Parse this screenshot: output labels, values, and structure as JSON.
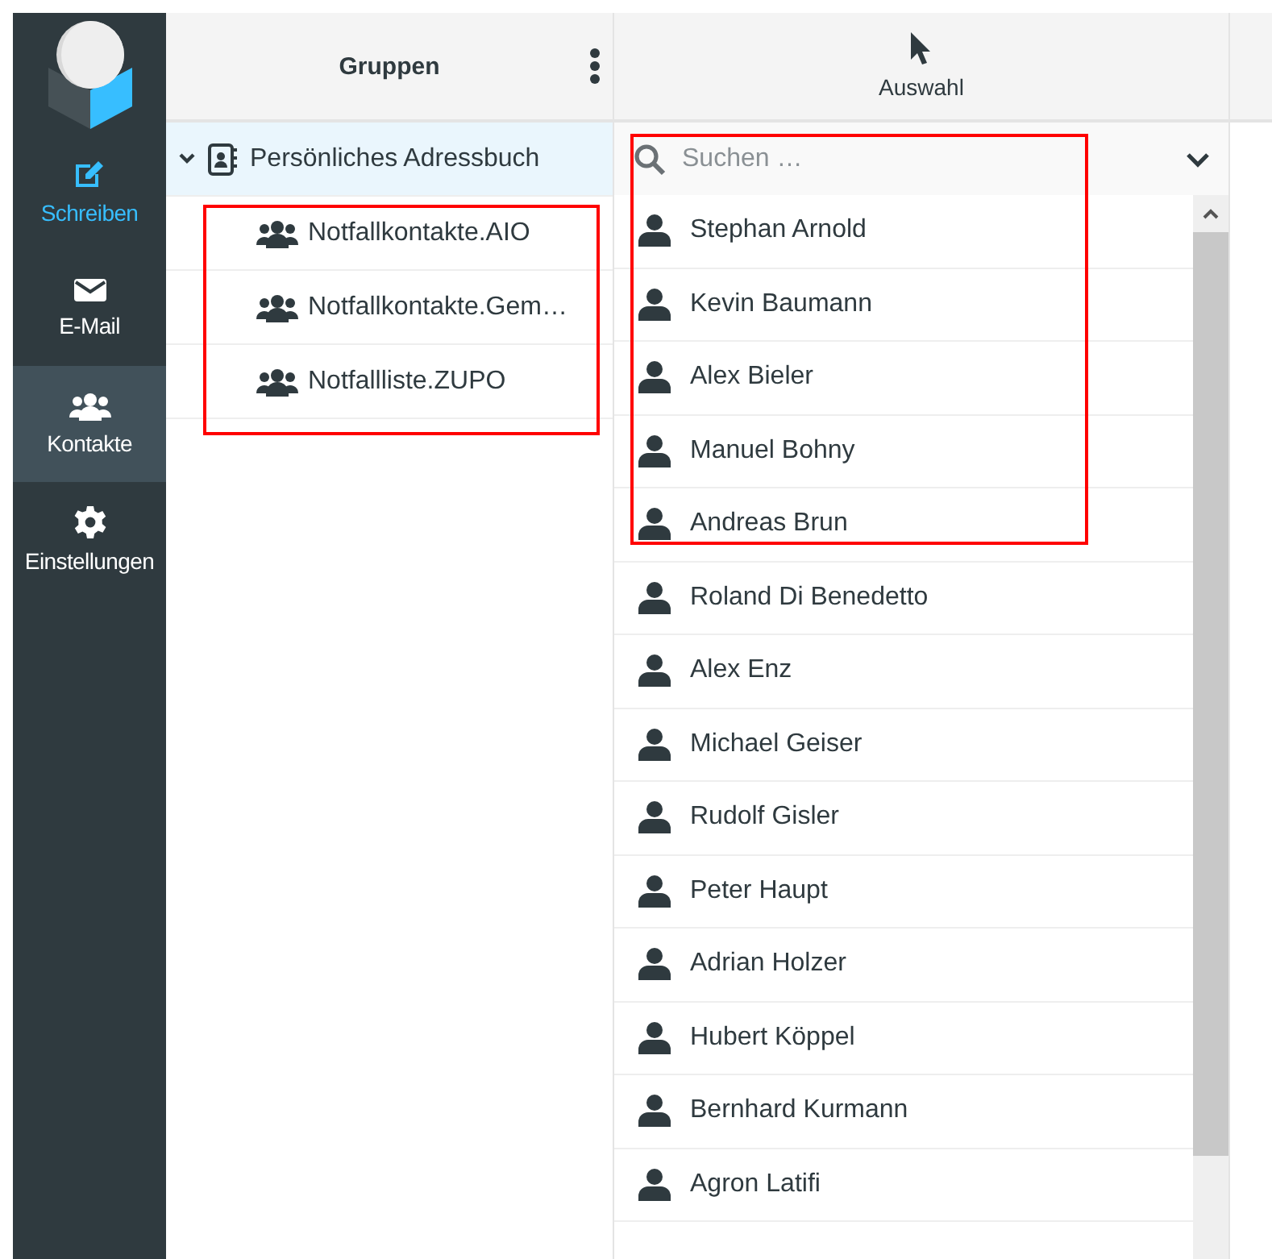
{
  "sidebar": {
    "items": [
      {
        "label": "Schreiben",
        "kind": "compose",
        "selected": false
      },
      {
        "label": "E-Mail",
        "kind": "mail",
        "selected": false
      },
      {
        "label": "Kontakte",
        "kind": "contacts",
        "selected": true
      },
      {
        "label": "Einstellungen",
        "kind": "settings",
        "selected": false
      }
    ]
  },
  "groups_panel": {
    "title": "Gruppen",
    "highlighted": true,
    "addressbook": {
      "label": "Persönliches Adressbuch",
      "expanded": true,
      "selected": true,
      "children": [
        {
          "label": "Notfallkontakte.AIO"
        },
        {
          "label": "Notfallkontakte.Gem…"
        },
        {
          "label": "Notfallliste.ZUPO"
        }
      ]
    }
  },
  "contacts_panel": {
    "title": "Auswahl",
    "highlighted": true,
    "search": {
      "placeholder": "Suchen …"
    },
    "contacts": [
      "Stephan Arnold",
      "Kevin Baumann",
      "Alex Bieler",
      "Manuel Bohny",
      "Andreas Brun",
      "Roland Di Benedetto",
      "Alex Enz",
      "Michael Geiser",
      "Rudolf Gisler",
      "Peter Haupt",
      "Adrian Holzer",
      "Hubert Köppel",
      "Bernhard Kurmann",
      "Agron Latifi"
    ]
  }
}
